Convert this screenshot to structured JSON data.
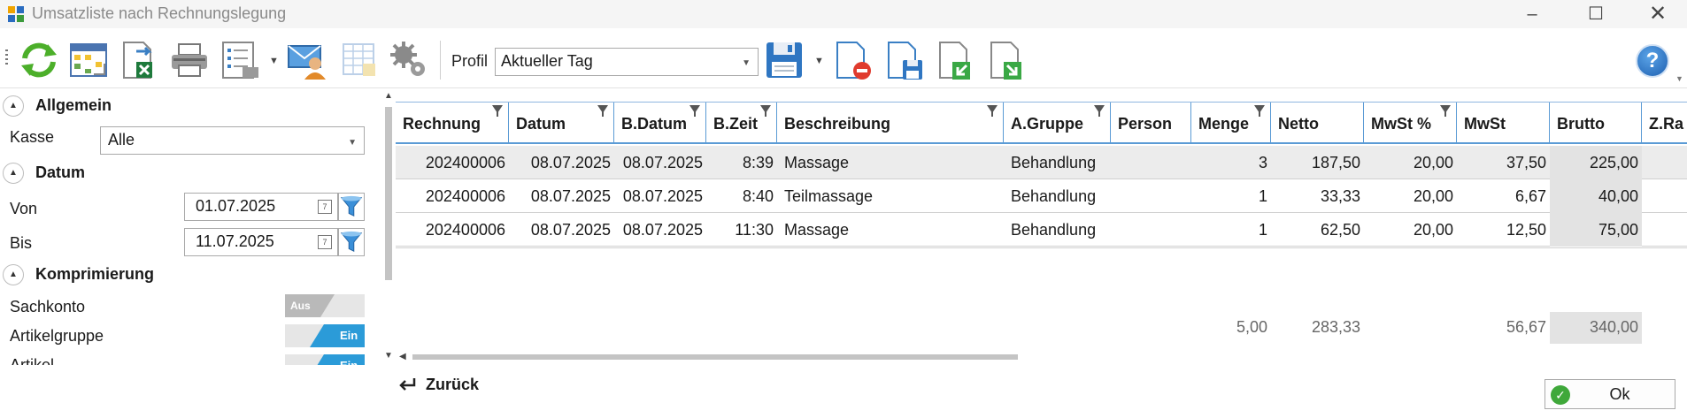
{
  "window": {
    "title": "Umsatzliste nach Rechnungslegung",
    "minimize_icon": "minimize-icon",
    "maximize_icon": "maximize-icon",
    "close_icon": "close-icon"
  },
  "toolbar": {
    "profile_label": "Profil",
    "profile_value": "Aktueller Tag",
    "icons": [
      "refresh-icon",
      "calendar-grid-icon",
      "excel-export-icon",
      "printer-icon",
      "report-list-icon",
      "email-user-icon",
      "table-icon",
      "settings-gears-icon",
      "save-icon",
      "delete-profile-icon",
      "save-profile-icon",
      "import-profile-icon",
      "export-profile-icon",
      "help-icon"
    ],
    "help_label": "?"
  },
  "left_panel": {
    "allgemein": {
      "title": "Allgemein",
      "kasse_label": "Kasse",
      "kasse_value": "Alle"
    },
    "datum": {
      "title": "Datum",
      "von_label": "Von",
      "von_value": "01.07.2025",
      "bis_label": "Bis",
      "bis_value": "11.07.2025"
    },
    "komprimierung": {
      "title": "Komprimierung",
      "items": [
        {
          "label": "Sachkonto",
          "state": "Aus"
        },
        {
          "label": "Artikelgruppe",
          "state": "Ein"
        },
        {
          "label": "Artikel",
          "state": "Ein"
        }
      ]
    }
  },
  "grid": {
    "columns": [
      "Rechnung",
      "Datum",
      "B.Datum",
      "B.Zeit",
      "Beschreibung",
      "A.Gruppe",
      "Person",
      "Menge",
      "Netto",
      "MwSt %",
      "MwSt",
      "Brutto",
      "Z.Ra"
    ],
    "rows": [
      {
        "rechnung": "202400006",
        "datum": "08.07.2025",
        "bdatum": "08.07.2025",
        "bzeit": "8:39",
        "beschreibung": "Massage",
        "agruppe": "Behandlung",
        "person": "",
        "menge": "3",
        "netto": "187,50",
        "mwstp": "20,00",
        "mwst": "37,50",
        "brutto": "225,00"
      },
      {
        "rechnung": "202400006",
        "datum": "08.07.2025",
        "bdatum": "08.07.2025",
        "bzeit": "8:40",
        "beschreibung": "Teilmassage",
        "agruppe": "Behandlung",
        "person": "",
        "menge": "1",
        "netto": "33,33",
        "mwstp": "20,00",
        "mwst": "6,67",
        "brutto": "40,00"
      },
      {
        "rechnung": "202400006",
        "datum": "08.07.2025",
        "bdatum": "08.07.2025",
        "bzeit": "11:30",
        "beschreibung": "Massage",
        "agruppe": "Behandlung",
        "person": "",
        "menge": "1",
        "netto": "62,50",
        "mwstp": "20,00",
        "mwst": "12,50",
        "brutto": "75,00"
      }
    ],
    "summary": {
      "menge": "5,00",
      "netto": "283,33",
      "mwst": "56,67",
      "brutto": "340,00"
    }
  },
  "footer": {
    "back_label": "Zurück",
    "ok_label": "Ok"
  },
  "colors": {
    "accent_blue": "#5b9bd5",
    "toggle_on": "#2b9bd8",
    "toggle_off": "#b9b9b9",
    "selected_row": "#ececec",
    "brutto_bg": "#e3e3e3"
  }
}
